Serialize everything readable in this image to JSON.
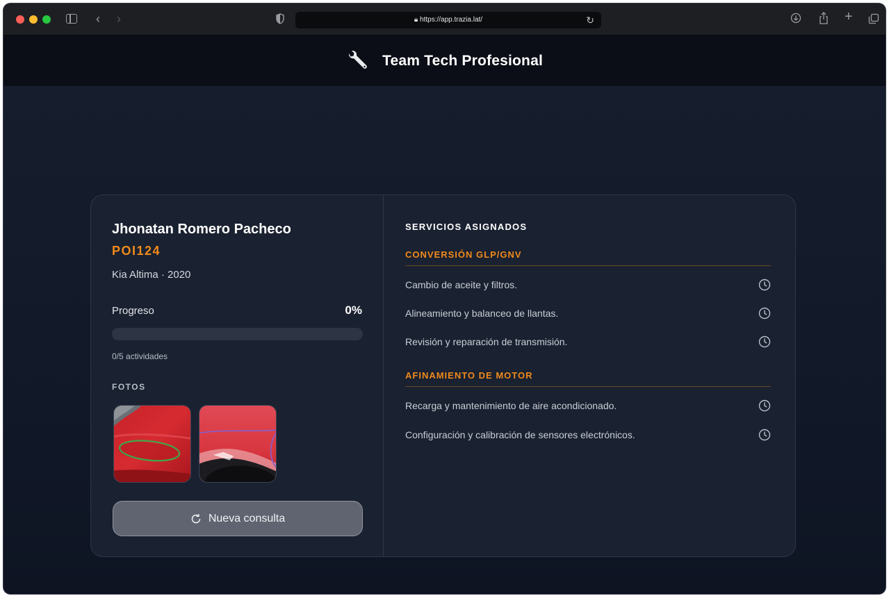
{
  "browser": {
    "url": "https://app.trazia.lat/"
  },
  "header": {
    "title": "Team Tech Profesional",
    "icon": "wrench-icon"
  },
  "client": {
    "name": "Jhonatan Romero Pacheco",
    "plate": "POI124",
    "vehicle": "Kia Altima · 2020"
  },
  "progress": {
    "label": "Progreso",
    "percent_text": "0%",
    "fraction": 0,
    "activities": "0/5 actividades"
  },
  "photos": {
    "heading": "FOTOS",
    "count": 2
  },
  "actions": {
    "new_query": "Nueva consulta"
  },
  "services": {
    "heading": "SERVICIOS ASIGNADOS",
    "groups": [
      {
        "title": "CONVERSIÓN GLP/GNV",
        "items": [
          "Cambio de aceite y filtros.",
          "Alineamiento y balanceo de llantas.",
          "Revisión y reparación de transmisión."
        ]
      },
      {
        "title": "AFINAMIENTO DE MOTOR",
        "items": [
          "Recarga y mantenimiento de aire acondicionado.",
          "Configuración y calibración de sensores electrónicos."
        ]
      }
    ],
    "status_icon": "clock-icon"
  },
  "colors": {
    "accent": "#f08a1c",
    "background": "#141b2a",
    "card": "#1a2130"
  }
}
